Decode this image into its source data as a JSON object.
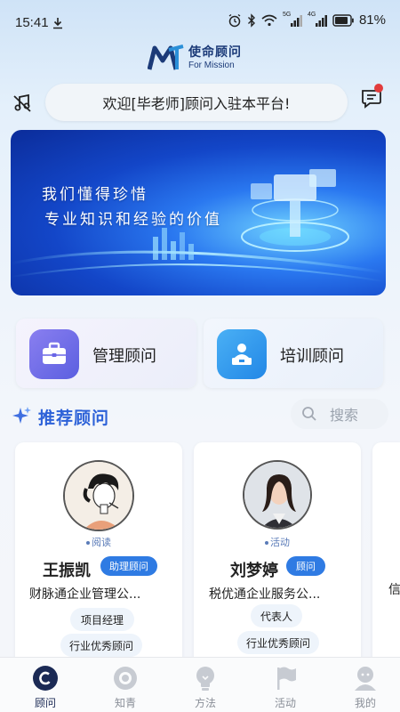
{
  "status_bar": {
    "time": "15:41",
    "battery": "81%",
    "signal_1": "5G",
    "signal_2": "4G"
  },
  "logo": {
    "cn": "使命顾问",
    "en": "For Mission"
  },
  "notice": {
    "text": "欢迎[毕老师]顾问入驻本平台!"
  },
  "banner": {
    "line1": "我们懂得珍惜",
    "line2": "专业知识和经验的价值"
  },
  "categories": [
    {
      "label": "管理顾问",
      "icon": "briefcase-icon"
    },
    {
      "label": "培训顾问",
      "icon": "presenter-icon"
    }
  ],
  "section": {
    "title": "推荐顾问",
    "search_placeholder": "搜索"
  },
  "advisors": [
    {
      "status": "阅读",
      "name": "王振凯",
      "tag": "助理顾问",
      "company": "财脉通企业管理公...",
      "pills": [
        "项目经理",
        "行业优秀顾问"
      ]
    },
    {
      "status": "活动",
      "name": "刘梦婷",
      "tag": "顾问",
      "company": "税优通企业服务公...",
      "pills": [
        "代表人",
        "行业优秀顾问"
      ]
    }
  ],
  "peek": {
    "char": "信"
  },
  "tabs": [
    {
      "label": "顾问",
      "icon": "c-logo-icon",
      "active": true
    },
    {
      "label": "知青",
      "icon": "lens-icon",
      "active": false
    },
    {
      "label": "方法",
      "icon": "bulb-icon",
      "active": false
    },
    {
      "label": "活动",
      "icon": "flag-icon",
      "active": false
    },
    {
      "label": "我的",
      "icon": "person-icon",
      "active": false
    }
  ],
  "colors": {
    "accent": "#2d62d8",
    "tag_blue": "#2f7be3",
    "badge_red": "#e23c3c",
    "nav_active": "#1b2a55"
  }
}
